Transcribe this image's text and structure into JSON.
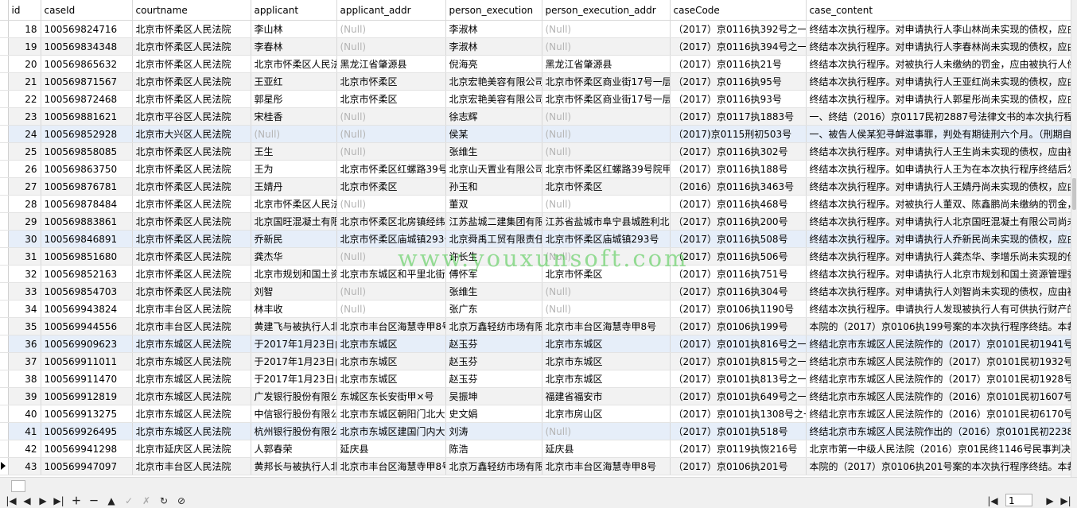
{
  "columns": [
    "id",
    "caseId",
    "courtname",
    "applicant",
    "applicant_addr",
    "person_execution",
    "person_execution_addr",
    "caseCode",
    "case_content"
  ],
  "null_text": "(Null)",
  "rows": [
    {
      "id": "18",
      "caseId": "100569824716",
      "courtname": "北京市怀柔区人民法院",
      "applicant": "李山林",
      "applicant_addr": null,
      "person_execution": "李淑林",
      "person_execution_addr": null,
      "caseCode": "（2017）京0116执392号之一",
      "case_content": "终结本次执行程序。对申请执行人李山林尚未实现的债权，应由"
    },
    {
      "id": "19",
      "caseId": "100569834348",
      "courtname": "北京市怀柔区人民法院",
      "applicant": "李春林",
      "applicant_addr": null,
      "person_execution": "李淑林",
      "person_execution_addr": null,
      "caseCode": "（2017）京0116执394号之一",
      "case_content": "终结本次执行程序。对申请执行人李春林尚未实现的债权，应由"
    },
    {
      "id": "20",
      "caseId": "100569865632",
      "courtname": "北京市怀柔区人民法院",
      "applicant": "北京市怀柔区人民法",
      "applicant_addr": "黑龙江省肇源县",
      "person_execution": "倪海亮",
      "person_execution_addr": "黑龙江省肇源县",
      "caseCode": "（2017）京0116执21号",
      "case_content": "终结本次执行程序。对被执行人未缴纳的罚金，应由被执行人偿"
    },
    {
      "id": "21",
      "caseId": "100569871567",
      "courtname": "北京市怀柔区人民法院",
      "applicant": "王亚红",
      "applicant_addr": "北京市怀柔区",
      "person_execution": "北京宏艳美容有限公司",
      "person_execution_addr": "北京市怀柔区商业街17号一层",
      "caseCode": "（2017）京0116执95号",
      "case_content": "终结本次执行程序。对申请执行人王亚红尚未实现的债权，应由"
    },
    {
      "id": "22",
      "caseId": "100569872468",
      "courtname": "北京市怀柔区人民法院",
      "applicant": "郭星彤",
      "applicant_addr": "北京市怀柔区",
      "person_execution": "北京宏艳美容有限公司",
      "person_execution_addr": "北京市怀柔区商业街17号一层",
      "caseCode": "（2017）京0116执93号",
      "case_content": "终结本次执行程序。对申请执行人郭星彤尚未实现的债权，应由"
    },
    {
      "id": "23",
      "caseId": "100569881621",
      "courtname": "北京市平谷区人民法院",
      "applicant": "宋桂香",
      "applicant_addr": null,
      "person_execution": "徐志辉",
      "person_execution_addr": null,
      "caseCode": "（2017）京0117执1883号",
      "case_content": "一、终结（2016）京0117民初2887号法律文书的本次执行程序"
    },
    {
      "id": "24",
      "caseId": "100569852928",
      "courtname": "北京市大兴区人民法院",
      "applicant": null,
      "applicant_addr": null,
      "person_execution": "侯某",
      "person_execution_addr": null,
      "caseCode": "（2017)京0115刑初503号",
      "case_content": "一、被告人侯某犯寻衅滋事罪，判处有期徒刑六个月。（刑期自"
    },
    {
      "id": "25",
      "caseId": "100569858085",
      "courtname": "北京市怀柔区人民法院",
      "applicant": "王生",
      "applicant_addr": null,
      "person_execution": "张维生",
      "person_execution_addr": null,
      "caseCode": "（2017）京0116执302号",
      "case_content": "终结本次执行程序。对申请执行人王生尚未实现的债权，应由被"
    },
    {
      "id": "26",
      "caseId": "100569863750",
      "courtname": "北京市怀柔区人民法院",
      "applicant": "王为",
      "applicant_addr": "北京市怀柔区红螺路39号",
      "person_execution": "北京山天置业有限公司",
      "person_execution_addr": "北京市怀柔区红螺路39号院甲",
      "caseCode": "（2017）京0116执188号",
      "case_content": "终结本次执行程序。如申请执行人王为在本次执行程序终结后发"
    },
    {
      "id": "27",
      "caseId": "100569876781",
      "courtname": "北京市怀柔区人民法院",
      "applicant": "王婧丹",
      "applicant_addr": "北京市怀柔区",
      "person_execution": "孙玉和",
      "person_execution_addr": "北京市怀柔区",
      "caseCode": "（2016）京0116执3463号",
      "case_content": "终结本次执行程序。对申请执行人王婧丹尚未实现的债权，应由"
    },
    {
      "id": "28",
      "caseId": "100569878484",
      "courtname": "北京市怀柔区人民法院",
      "applicant": "北京市怀柔区人民法",
      "applicant_addr": null,
      "person_execution": "董双",
      "person_execution_addr": null,
      "caseCode": "（2017）京0116执468号",
      "case_content": "终结本次执行程序。对被执行人董双、陈鑫鹏尚未缴纳的罚金，"
    },
    {
      "id": "29",
      "caseId": "100569883861",
      "courtname": "北京市怀柔区人民法院",
      "applicant": "北京国旺混凝土有限",
      "applicant_addr": "北京市怀柔区北房镇经纬",
      "person_execution": "江苏盐城二建集团有限",
      "person_execution_addr": "江苏省盐城市阜宁县城胜利北",
      "caseCode": "（2017）京0116执200号",
      "case_content": "终结本次执行程序。对申请执行人北京国旺混凝土有限公司尚未"
    },
    {
      "id": "30",
      "caseId": "100569846891",
      "courtname": "北京市怀柔区人民法院",
      "applicant": "乔新民",
      "applicant_addr": "北京市怀柔区庙城镇293号",
      "person_execution": "北京舜禹工贸有限责任",
      "person_execution_addr": "北京市怀柔区庙城镇293号",
      "caseCode": "（2017）京0116执508号",
      "case_content": "终结本次执行程序。对申请执行人乔新民尚未实现的债权，应由"
    },
    {
      "id": "31",
      "caseId": "100569851680",
      "courtname": "北京市怀柔区人民法院",
      "applicant": "龚杰华",
      "applicant_addr": null,
      "person_execution": "许长生",
      "person_execution_addr": null,
      "caseCode": "（2017）京0116执506号",
      "case_content": "终结本次执行程序。对申请执行人龚杰华、李增乐尚未实现的债"
    },
    {
      "id": "32",
      "caseId": "100569852163",
      "courtname": "北京市怀柔区人民法院",
      "applicant": "北京市规划和国土资",
      "applicant_addr": "北京市东城区和平里北街",
      "person_execution": "傅怀军",
      "person_execution_addr": "北京市怀柔区",
      "caseCode": "（2017）京0116执751号",
      "case_content": "终结本次执行程序。对申请执行人北京市规划和国土资源管理委"
    },
    {
      "id": "33",
      "caseId": "100569854703",
      "courtname": "北京市怀柔区人民法院",
      "applicant": "刘智",
      "applicant_addr": null,
      "person_execution": "张维生",
      "person_execution_addr": null,
      "caseCode": "（2017）京0116执304号",
      "case_content": "终结本次执行程序。对申请执行人刘智尚未实现的债权，应由被"
    },
    {
      "id": "34",
      "caseId": "100569943824",
      "courtname": "北京市丰台区人民法院",
      "applicant": "林丰收",
      "applicant_addr": null,
      "person_execution": "张广东",
      "person_execution_addr": null,
      "caseCode": "（2017）京0106执1190号",
      "case_content": "终结本次执行程序。申请执行人发现被执行人有可供执行财产的"
    },
    {
      "id": "35",
      "caseId": "100569944556",
      "courtname": "北京市丰台区人民法院",
      "applicant": "黄建飞与被执行人北",
      "applicant_addr": "北京市丰台区海慧寺甲8号",
      "person_execution": "北京万鑫轻纺市场有限",
      "person_execution_addr": "北京市丰台区海慧寺甲8号",
      "caseCode": "（2017）京0106执199号",
      "case_content": "本院的（2017）京0106执199号案的本次执行程序终结。本裁"
    },
    {
      "id": "36",
      "caseId": "100569909623",
      "courtname": "北京市东城区人民法院",
      "applicant": "于2017年1月23日向",
      "applicant_addr": "北京市东城区",
      "person_execution": "赵玉芬",
      "person_execution_addr": "北京市东城区",
      "caseCode": "（2017）京0101执816号之一",
      "case_content": "终结北京市东城区人民法院作的（2017）京0101民初1941号民"
    },
    {
      "id": "37",
      "caseId": "100569911011",
      "courtname": "北京市东城区人民法院",
      "applicant": "于2017年1月23日向",
      "applicant_addr": "北京市东城区",
      "person_execution": "赵玉芬",
      "person_execution_addr": "北京市东城区",
      "caseCode": "（2017）京0101执815号之一",
      "case_content": "终结北京市东城区人民法院作的（2017）京0101民初1932号民"
    },
    {
      "id": "38",
      "caseId": "100569911470",
      "courtname": "北京市东城区人民法院",
      "applicant": "于2017年1月23日向",
      "applicant_addr": "北京市东城区",
      "person_execution": "赵玉芬",
      "person_execution_addr": "北京市东城区",
      "caseCode": "（2017）京0101执813号之一",
      "case_content": "终结北京市东城区人民法院作的（2017）京0101民初1928号民"
    },
    {
      "id": "39",
      "caseId": "100569912819",
      "courtname": "北京市东城区人民法院",
      "applicant": "广发银行股份有限公",
      "applicant_addr": "东城区东长安街甲×号",
      "person_execution": "吴振坤",
      "person_execution_addr": "福建省福安市",
      "caseCode": "（2017）京0101执649号之一",
      "case_content": "终结北京市东城区人民法院作的（2016）京0101民初1607号民"
    },
    {
      "id": "40",
      "caseId": "100569913275",
      "courtname": "北京市东城区人民法院",
      "applicant": "中信银行股份有限公",
      "applicant_addr": "北京市东城区朝阳门北大",
      "person_execution": "史文娟",
      "person_execution_addr": "北京市房山区",
      "caseCode": "（2017）京0101执1308号之一",
      "case_content": "终结北京市东城区人民法院作的（2016）京0101民初6170号民"
    },
    {
      "id": "41",
      "caseId": "100569926495",
      "courtname": "北京市东城区人民法院",
      "applicant": "杭州银行股份有限公",
      "applicant_addr": "北京市东城区建国门内大",
      "person_execution": "刘涛",
      "person_execution_addr": null,
      "caseCode": "（2017）京0101执518号",
      "case_content": "终结北京市东城区人民法院作出的（2016）京0101民初2238号"
    },
    {
      "id": "42",
      "caseId": "100569941298",
      "courtname": "北京市延庆区人民法院",
      "applicant": "人郭春荣",
      "applicant_addr": "延庆县",
      "person_execution": "陈浩",
      "person_execution_addr": "延庆县",
      "caseCode": "（2017）京0119执恢216号",
      "case_content": "北京市第一中级人民法院（2016）京01民终1146号民事判决书"
    },
    {
      "id": "43",
      "caseId": "100569947097",
      "courtname": "北京市丰台区人民法院",
      "applicant": "黄邦长与被执行人北",
      "applicant_addr": "北京市丰台区海慧寺甲8号",
      "person_execution": "北京万鑫轻纺市场有限",
      "person_execution_addr": "北京市丰台区海慧寺甲8号",
      "caseCode": "（2017）京0106执201号",
      "case_content": "本院的（2017）京0106执201号案的本次执行程序终结。本裁"
    }
  ],
  "watermark": "www.youxunsoft.com",
  "toolbar": {
    "first": "first-record-icon",
    "prev": "prev-record-icon",
    "next": "next-record-icon",
    "last": "last-record-icon",
    "add": "add-record-icon",
    "delete": "delete-record-icon",
    "up": "move-up-icon",
    "apply": "apply-icon",
    "cancel": "cancel-edit-icon",
    "refresh": "refresh-icon",
    "stop": "stop-icon",
    "page": "1"
  },
  "colors": {
    "selected_row": "#e6eef9",
    "alt_row": "#f2f2f2",
    "null_text": "#b4b4b4",
    "watermark": "#46c846"
  }
}
